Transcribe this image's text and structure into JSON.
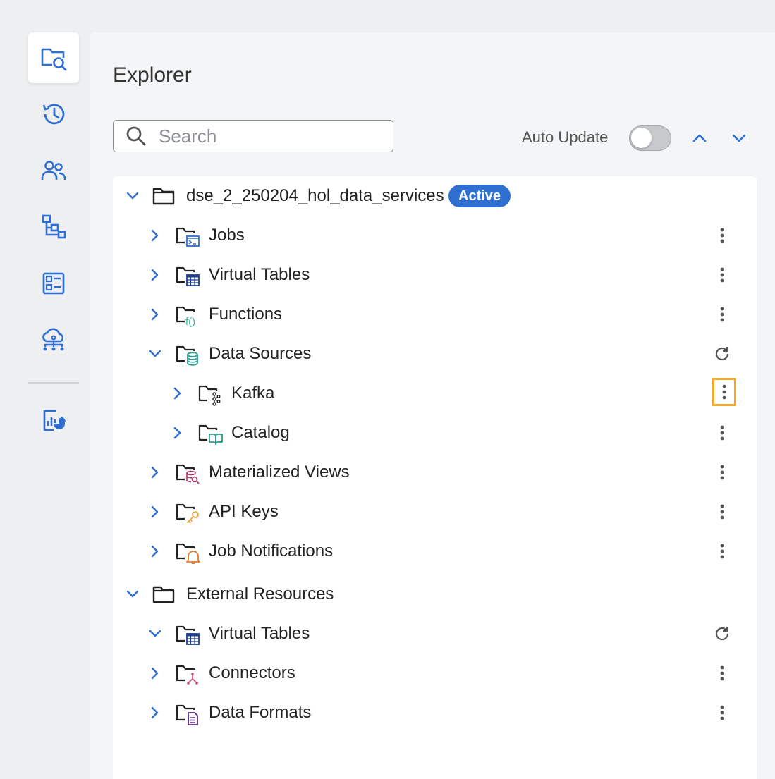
{
  "rail": {
    "items": [
      {
        "name": "explorer",
        "icon": "folder-search-icon",
        "active": true
      },
      {
        "name": "history",
        "icon": "history-icon"
      },
      {
        "name": "users",
        "icon": "users-icon"
      },
      {
        "name": "hierarchy",
        "icon": "hierarchy-icon"
      },
      {
        "name": "dashboard",
        "icon": "dashboard-icon"
      },
      {
        "name": "cloud-network",
        "icon": "cloud-network-icon"
      },
      {
        "name": "reports",
        "icon": "chart-report-icon"
      }
    ],
    "accent": "#2f6fd1"
  },
  "explorer": {
    "title": "Explorer",
    "search_placeholder": "Search",
    "search_value": "",
    "auto_update_label": "Auto Update",
    "auto_update_on": false
  },
  "tree": {
    "project": {
      "label": "dse_2_250204_hol_data_services",
      "badge": "Active",
      "badge_color": "#2f6fd1",
      "children": [
        {
          "label": "Jobs",
          "icon": "jobs-icon",
          "action": "more"
        },
        {
          "label": "Virtual Tables",
          "icon": "table-icon",
          "action": "more"
        },
        {
          "label": "Functions",
          "icon": "function-icon",
          "action": "more"
        },
        {
          "label": "Data Sources",
          "icon": "database-icon",
          "action": "refresh",
          "children": [
            {
              "label": "Kafka",
              "icon": "kafka-icon",
              "action": "more",
              "focused": true
            },
            {
              "label": "Catalog",
              "icon": "book-icon",
              "action": "more"
            }
          ]
        },
        {
          "label": "Materialized Views",
          "icon": "materialized-view-icon",
          "action": "more"
        },
        {
          "label": "API Keys",
          "icon": "key-icon",
          "action": "more"
        },
        {
          "label": "Job Notifications",
          "icon": "bell-icon",
          "action": "more"
        }
      ]
    },
    "external": {
      "label": "External Resources",
      "children": [
        {
          "label": "Virtual Tables",
          "icon": "table-icon",
          "action": "refresh"
        },
        {
          "label": "Connectors",
          "icon": "connector-icon",
          "action": "more"
        },
        {
          "label": "Data Formats",
          "icon": "document-icon",
          "action": "more"
        }
      ]
    }
  }
}
